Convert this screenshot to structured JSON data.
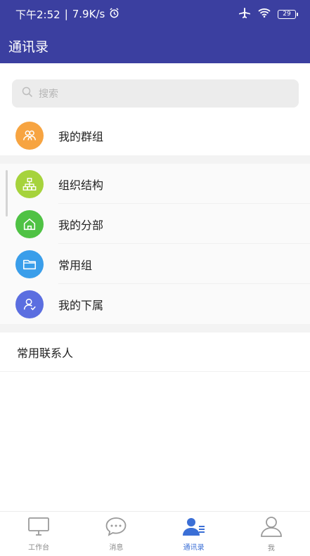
{
  "status_bar": {
    "time": "下午2:52",
    "speed": "7.9K/s",
    "battery": "29"
  },
  "header": {
    "title": "通讯录"
  },
  "search": {
    "placeholder": "搜索"
  },
  "groups": [
    {
      "label": "我的群组",
      "icon": "group-icon",
      "color": "#f7a441"
    }
  ],
  "org": [
    {
      "label": "组织结构",
      "icon": "org-chart-icon",
      "color": "#a6d33c"
    },
    {
      "label": "我的分部",
      "icon": "home-icon",
      "color": "#4fc244"
    },
    {
      "label": "常用组",
      "icon": "folder-icon",
      "color": "#3a9eea"
    },
    {
      "label": "我的下属",
      "icon": "subordinate-icon",
      "color": "#5b6ee0"
    }
  ],
  "section": {
    "title": "常用联系人"
  },
  "nav": [
    {
      "label": "工作台",
      "icon": "monitor-icon"
    },
    {
      "label": "消息",
      "icon": "chat-icon"
    },
    {
      "label": "通讯录",
      "icon": "contacts-icon",
      "active": true
    },
    {
      "label": "我",
      "icon": "person-icon"
    }
  ]
}
